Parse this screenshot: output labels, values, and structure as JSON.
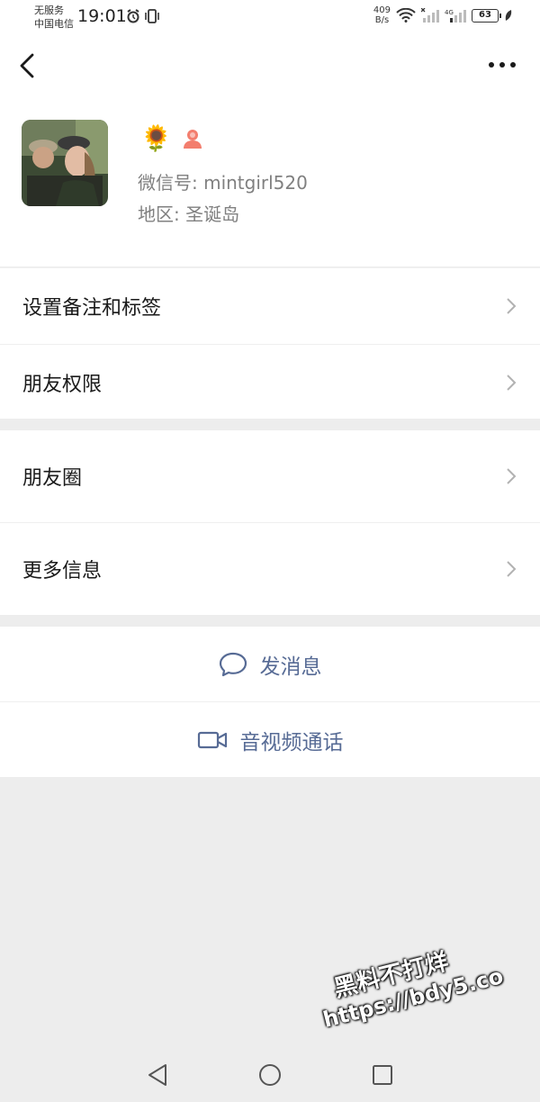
{
  "status_bar": {
    "carrier_line1": "无服务",
    "carrier_line2": "中国电信",
    "time": "19:01",
    "net_speed_value": "409",
    "net_speed_unit": "B/s",
    "battery": "63"
  },
  "nav": {
    "back_icon": "chevron-left-icon",
    "more_icon": "more-dots-icon"
  },
  "profile": {
    "nickname_emoji": "🌻",
    "wechat_id": "微信号: mintgirl520",
    "region": "地区: 圣诞岛"
  },
  "menu": {
    "remark_tags": "设置备注和标签",
    "friend_permissions": "朋友权限",
    "moments": "朋友圈",
    "more_info": "更多信息"
  },
  "actions": {
    "send_message": "发消息",
    "voice_video_call": "音视频通话"
  },
  "watermark": {
    "line1": "黑料不打烊",
    "line2": "https://bdy5.co"
  },
  "colors": {
    "link_blue": "#576b95",
    "chevron": "#b2b2b2",
    "gray_text": "#808080"
  }
}
